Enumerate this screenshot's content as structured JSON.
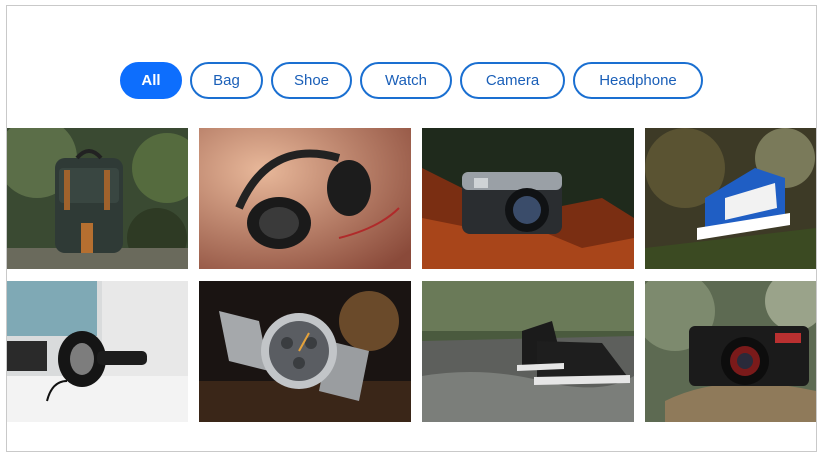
{
  "filters": [
    {
      "label": "All",
      "active": true
    },
    {
      "label": "Bag",
      "active": false
    },
    {
      "label": "Shoe",
      "active": false
    },
    {
      "label": "Watch",
      "active": false
    },
    {
      "label": "Camera",
      "active": false
    },
    {
      "label": "Headphone",
      "active": false
    }
  ],
  "gallery": {
    "items": [
      {
        "icon": "backpack-photo",
        "category": "Bag"
      },
      {
        "icon": "headphone-photo",
        "category": "Headphone"
      },
      {
        "icon": "camera-photo",
        "category": "Camera"
      },
      {
        "icon": "sneaker-photo",
        "category": "Shoe"
      },
      {
        "icon": "headphone-desk-photo",
        "category": "Headphone"
      },
      {
        "icon": "watch-photo",
        "category": "Watch"
      },
      {
        "icon": "shoe-rocks-photo",
        "category": "Shoe"
      },
      {
        "icon": "camera-vintage-photo",
        "category": "Camera"
      }
    ]
  },
  "colors": {
    "accent": "#0d6efd",
    "border": "#1a6fd1"
  }
}
